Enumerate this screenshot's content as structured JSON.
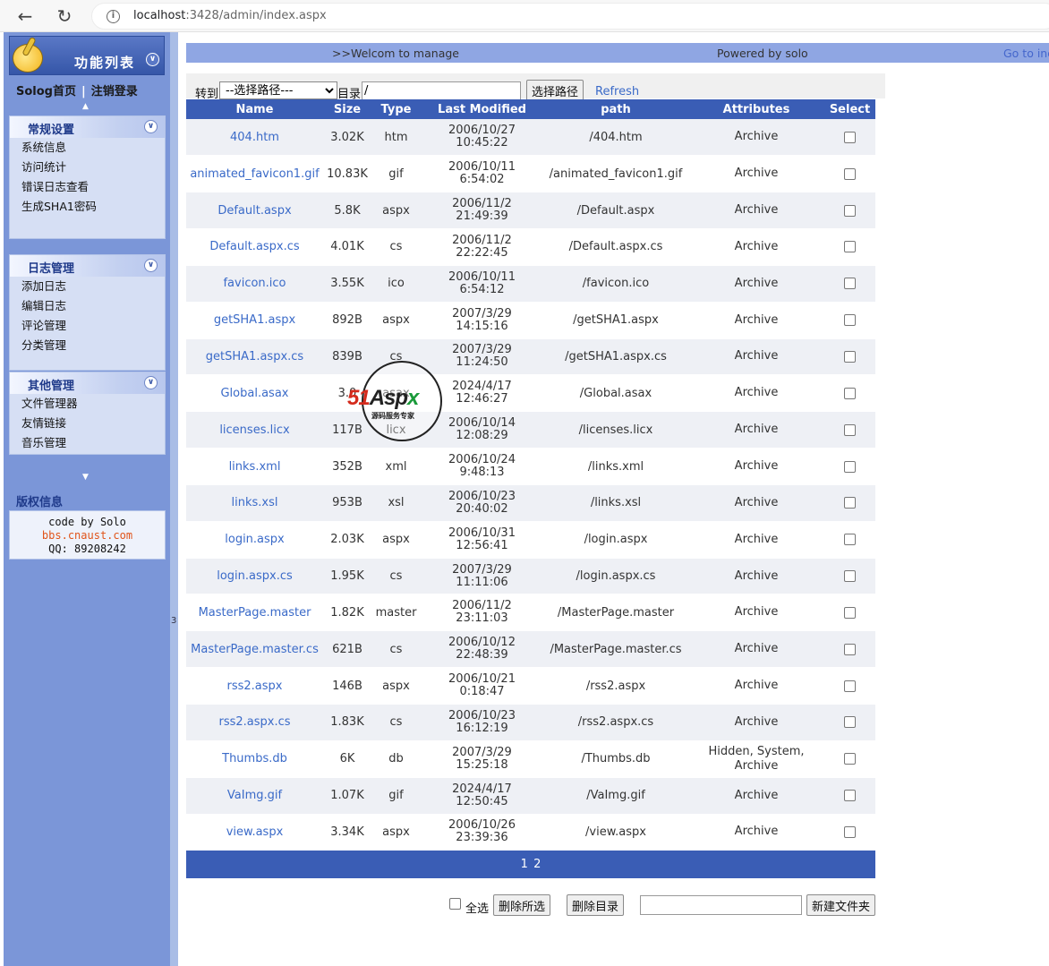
{
  "browser": {
    "url_host": "localhost",
    "url_rest": ":3428/admin/index.aspx"
  },
  "sidebar": {
    "logo_title": "功能列表",
    "top_links": {
      "home": "Solog首页",
      "separator": "|",
      "logout": "注销登录"
    },
    "groups": [
      {
        "title": "常规设置",
        "items": [
          "系统信息",
          "访问统计",
          "错误日志查看",
          "生成SHA1密码"
        ]
      },
      {
        "title": "日志管理",
        "items": [
          "添加日志",
          "编辑日志",
          "评论管理",
          "分类管理"
        ]
      },
      {
        "title": "其他管理",
        "items": [
          "文件管理器",
          "友情链接",
          "音乐管理"
        ]
      }
    ],
    "copyright_title": "版权信息",
    "copyright_lines": {
      "line1": "code by Solo",
      "link": "bbs.cnaust.com",
      "qq": "QQ: 89208242"
    }
  },
  "splitter_mark": "3",
  "header": {
    "welcome": ">>Welcom to manage",
    "powered": "Powered by solo",
    "goto": "Go to index"
  },
  "path_bar": {
    "goto_label": "转到",
    "select_value": "--选择路径---",
    "dir_label": "目录",
    "dir_value": "/",
    "select_button": "选择路径",
    "refresh": "Refresh"
  },
  "table": {
    "headers": [
      "Name",
      "Size",
      "Type",
      "Last Modified",
      "path",
      "Attributes",
      "Select"
    ],
    "rows": [
      {
        "name": "404.htm",
        "size": "3.02K",
        "type": "htm",
        "date": "2006/10/27",
        "time": "10:45:22",
        "path": "/404.htm",
        "attr1": "Archive",
        "attr2": ""
      },
      {
        "name": "animated_favicon1.gif",
        "size": "10.83K",
        "type": "gif",
        "date": "2006/10/11",
        "time": "6:54:02",
        "path": "/animated_favicon1.gif",
        "attr1": "Archive",
        "attr2": ""
      },
      {
        "name": "Default.aspx",
        "size": "5.8K",
        "type": "aspx",
        "date": "2006/11/2",
        "time": "21:49:39",
        "path": "/Default.aspx",
        "attr1": "Archive",
        "attr2": ""
      },
      {
        "name": "Default.aspx.cs",
        "size": "4.01K",
        "type": "cs",
        "date": "2006/11/2",
        "time": "22:22:45",
        "path": "/Default.aspx.cs",
        "attr1": "Archive",
        "attr2": ""
      },
      {
        "name": "favicon.ico",
        "size": "3.55K",
        "type": "ico",
        "date": "2006/10/11",
        "time": "6:54:12",
        "path": "/favicon.ico",
        "attr1": "Archive",
        "attr2": ""
      },
      {
        "name": "getSHA1.aspx",
        "size": "892B",
        "type": "aspx",
        "date": "2007/3/29",
        "time": "14:15:16",
        "path": "/getSHA1.aspx",
        "attr1": "Archive",
        "attr2": ""
      },
      {
        "name": "getSHA1.aspx.cs",
        "size": "839B",
        "type": "cs",
        "date": "2007/3/29",
        "time": "11:24:50",
        "path": "/getSHA1.aspx.cs",
        "attr1": "Archive",
        "attr2": ""
      },
      {
        "name": "Global.asax",
        "size": "3.0",
        "type": "asax",
        "date": "2024/4/17",
        "time": "12:46:27",
        "path": "/Global.asax",
        "attr1": "Archive",
        "attr2": ""
      },
      {
        "name": "licenses.licx",
        "size": "117B",
        "type": "licx",
        "date": "2006/10/14",
        "time": "12:08:29",
        "path": "/licenses.licx",
        "attr1": "Archive",
        "attr2": ""
      },
      {
        "name": "links.xml",
        "size": "352B",
        "type": "xml",
        "date": "2006/10/24",
        "time": "9:48:13",
        "path": "/links.xml",
        "attr1": "Archive",
        "attr2": ""
      },
      {
        "name": "links.xsl",
        "size": "953B",
        "type": "xsl",
        "date": "2006/10/23",
        "time": "20:40:02",
        "path": "/links.xsl",
        "attr1": "Archive",
        "attr2": ""
      },
      {
        "name": "login.aspx",
        "size": "2.03K",
        "type": "aspx",
        "date": "2006/10/31",
        "time": "12:56:41",
        "path": "/login.aspx",
        "attr1": "Archive",
        "attr2": ""
      },
      {
        "name": "login.aspx.cs",
        "size": "1.95K",
        "type": "cs",
        "date": "2007/3/29",
        "time": "11:11:06",
        "path": "/login.aspx.cs",
        "attr1": "Archive",
        "attr2": ""
      },
      {
        "name": "MasterPage.master",
        "size": "1.82K",
        "type": "master",
        "date": "2006/11/2",
        "time": "23:11:03",
        "path": "/MasterPage.master",
        "attr1": "Archive",
        "attr2": ""
      },
      {
        "name": "MasterPage.master.cs",
        "size": "621B",
        "type": "cs",
        "date": "2006/10/12",
        "time": "22:48:39",
        "path": "/MasterPage.master.cs",
        "attr1": "Archive",
        "attr2": ""
      },
      {
        "name": "rss2.aspx",
        "size": "146B",
        "type": "aspx",
        "date": "2006/10/21",
        "time": "0:18:47",
        "path": "/rss2.aspx",
        "attr1": "Archive",
        "attr2": ""
      },
      {
        "name": "rss2.aspx.cs",
        "size": "1.83K",
        "type": "cs",
        "date": "2006/10/23",
        "time": "16:12:19",
        "path": "/rss2.aspx.cs",
        "attr1": "Archive",
        "attr2": ""
      },
      {
        "name": "Thumbs.db",
        "size": "6K",
        "type": "db",
        "date": "2007/3/29",
        "time": "15:25:18",
        "path": "/Thumbs.db",
        "attr1": "Hidden, System,",
        "attr2": "Archive"
      },
      {
        "name": "VaImg.gif",
        "size": "1.07K",
        "type": "gif",
        "date": "2024/4/17",
        "time": "12:50:45",
        "path": "/VaImg.gif",
        "attr1": "Archive",
        "attr2": ""
      },
      {
        "name": "view.aspx",
        "size": "3.34K",
        "type": "aspx",
        "date": "2006/10/26",
        "time": "23:39:36",
        "path": "/view.aspx",
        "attr1": "Archive",
        "attr2": ""
      }
    ]
  },
  "pager": {
    "pages": [
      "1",
      "2"
    ]
  },
  "actions": {
    "select_all": "全选",
    "delete_selected": "删除所选",
    "delete_dir": "删除目录",
    "new_folder": "新建文件夹",
    "new_folder_value": ""
  },
  "watermark": {
    "brand_51": "51",
    "brand_asp": "Asp",
    "brand_x": "x",
    "tagline": "源码服务专家"
  }
}
